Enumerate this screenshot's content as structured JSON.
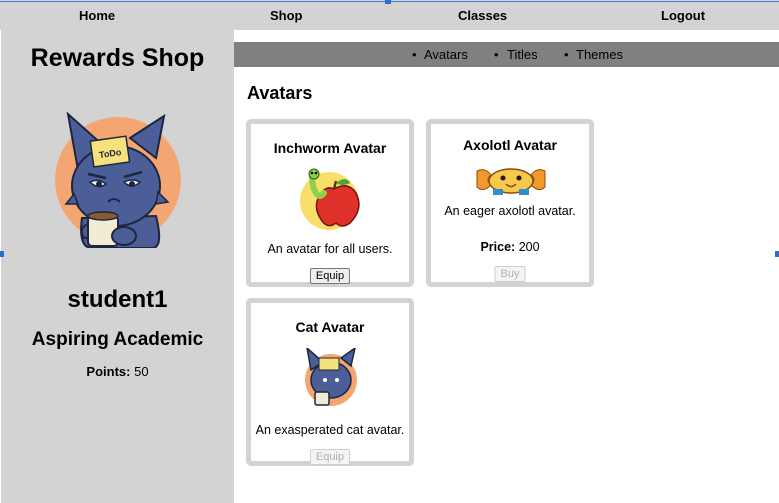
{
  "nav": {
    "home": "Home",
    "shop": "Shop",
    "classes": "Classes",
    "logout": "Logout"
  },
  "sidebar": {
    "title": "Rewards Shop",
    "username": "student1",
    "rank": "Aspiring Academic",
    "points_label": "Points:",
    "points_value": "50"
  },
  "subnav": {
    "items": [
      "Avatars",
      "Titles",
      "Themes"
    ]
  },
  "section_title": "Avatars",
  "cards": [
    {
      "title": "Inchworm Avatar",
      "description": "An avatar for all users.",
      "button": "Equip",
      "button_enabled": true
    },
    {
      "title": "Axolotl Avatar",
      "description": "An eager axolotl avatar.",
      "price_label": "Price:",
      "price_value": "200",
      "button": "Buy",
      "button_enabled": false
    },
    {
      "title": "Cat Avatar",
      "description": "An exasperated cat avatar.",
      "button": "Equip",
      "button_enabled": false
    }
  ],
  "icons": {
    "big_avatar": "cat-with-coffee-icon",
    "note_text": "ToDo"
  },
  "colors": {
    "nav_bg": "#d3d3d3",
    "subnav_bg": "#808080",
    "avatar_circle": "#f4a672",
    "cat_body": "#4b5e98"
  }
}
